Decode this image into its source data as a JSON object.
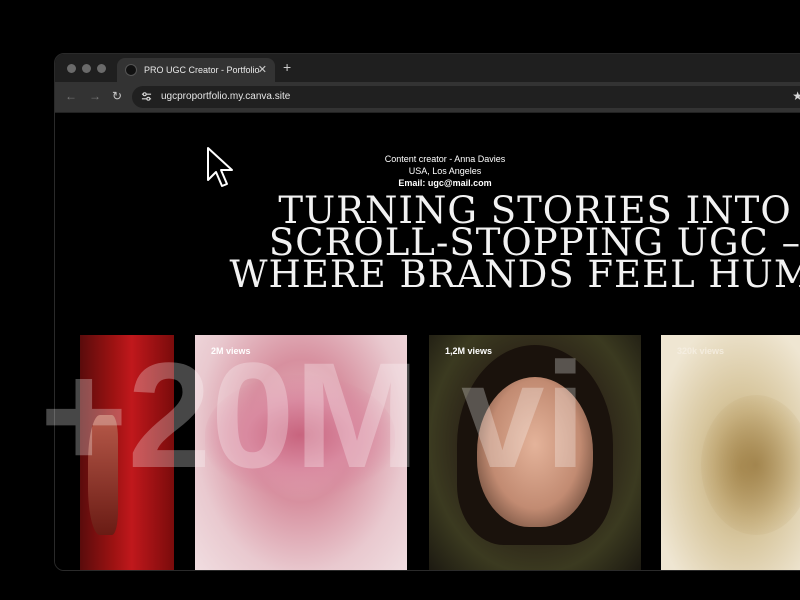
{
  "browser": {
    "tab_title": "PRO UGC Creator - Portfolio",
    "tab_close": "✕",
    "new_tab": "+",
    "url": "ugcproportfolio.my.canva.site",
    "nav_back": "←",
    "nav_forward": "→",
    "nav_reload": "↻",
    "bookmark": "★"
  },
  "page": {
    "creator_line": "Content creator - Anna Davies",
    "location": "USA, Los Angeles",
    "email": "Email: ugc@mail.com",
    "headline_lines": [
      "TURNING STORIES INTO",
      "SCROLL-STOPPING UGC –",
      "WHERE BRANDS FEEL HUMA"
    ],
    "overlay_text": "+20M vi"
  },
  "cards": [
    {
      "views": ""
    },
    {
      "views": "2M views"
    },
    {
      "views": "1,2M views"
    },
    {
      "views": "320k views"
    }
  ],
  "colors": {
    "background": "#000000",
    "tab_bar": "#1f1f1f",
    "toolbar": "#333333"
  },
  "icons": [
    "traffic-light",
    "favicon",
    "close",
    "plus",
    "arrow-left",
    "arrow-right",
    "reload",
    "tune",
    "star",
    "cursor"
  ]
}
